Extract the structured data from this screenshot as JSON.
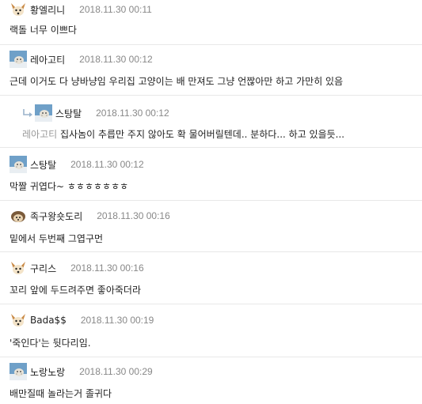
{
  "comments": [
    {
      "author": "황엘리니",
      "date": "2018.11.30 00:11",
      "text": "랙돌 너무 이쁘다",
      "avatar": "fennec-fox-icon"
    },
    {
      "author": "레아고티",
      "date": "2018.11.30 00:12",
      "text": "근데 이거도 다 냥바냥임 우리집 고양이는 배 만져도 그냥 언짢아만 하고 가만히 있음",
      "avatar": "snow-leopard-icon"
    },
    {
      "author": "스탕탈",
      "date": "2018.11.30 00:12",
      "mention": "레아고티",
      "text": "집사놈이 추릅만 주지 않아도 확 물어버릴텐데.. 분하다... 하고 있을듯...",
      "avatar": "snow-leopard-icon",
      "reply": true
    },
    {
      "author": "스탕탈",
      "date": "2018.11.30 00:12",
      "text": "막짤 귀엽다~ ㅎㅎㅎㅎㅎㅎㅎ",
      "avatar": "snow-leopard-icon"
    },
    {
      "author": "족구왕숏도리",
      "date": "2018.11.30 00:16",
      "text": "밑에서 두번째 그엽구먼",
      "avatar": "hedgehog-icon"
    },
    {
      "author": "구리스",
      "date": "2018.11.30 00:16",
      "text": "꼬리 앞에 두드려주면 좋아죽더라",
      "avatar": "fennec-fox-icon"
    },
    {
      "author": "Bada$$",
      "date": "2018.11.30 00:19",
      "text": "'죽인다'는 뒷다리임.",
      "avatar": "fennec-fox-icon"
    },
    {
      "author": "노랑노랑",
      "date": "2018.11.30 00:29",
      "text": "배만질때 놀라는거 졸귀다",
      "avatar": "snow-leopard-icon"
    }
  ]
}
